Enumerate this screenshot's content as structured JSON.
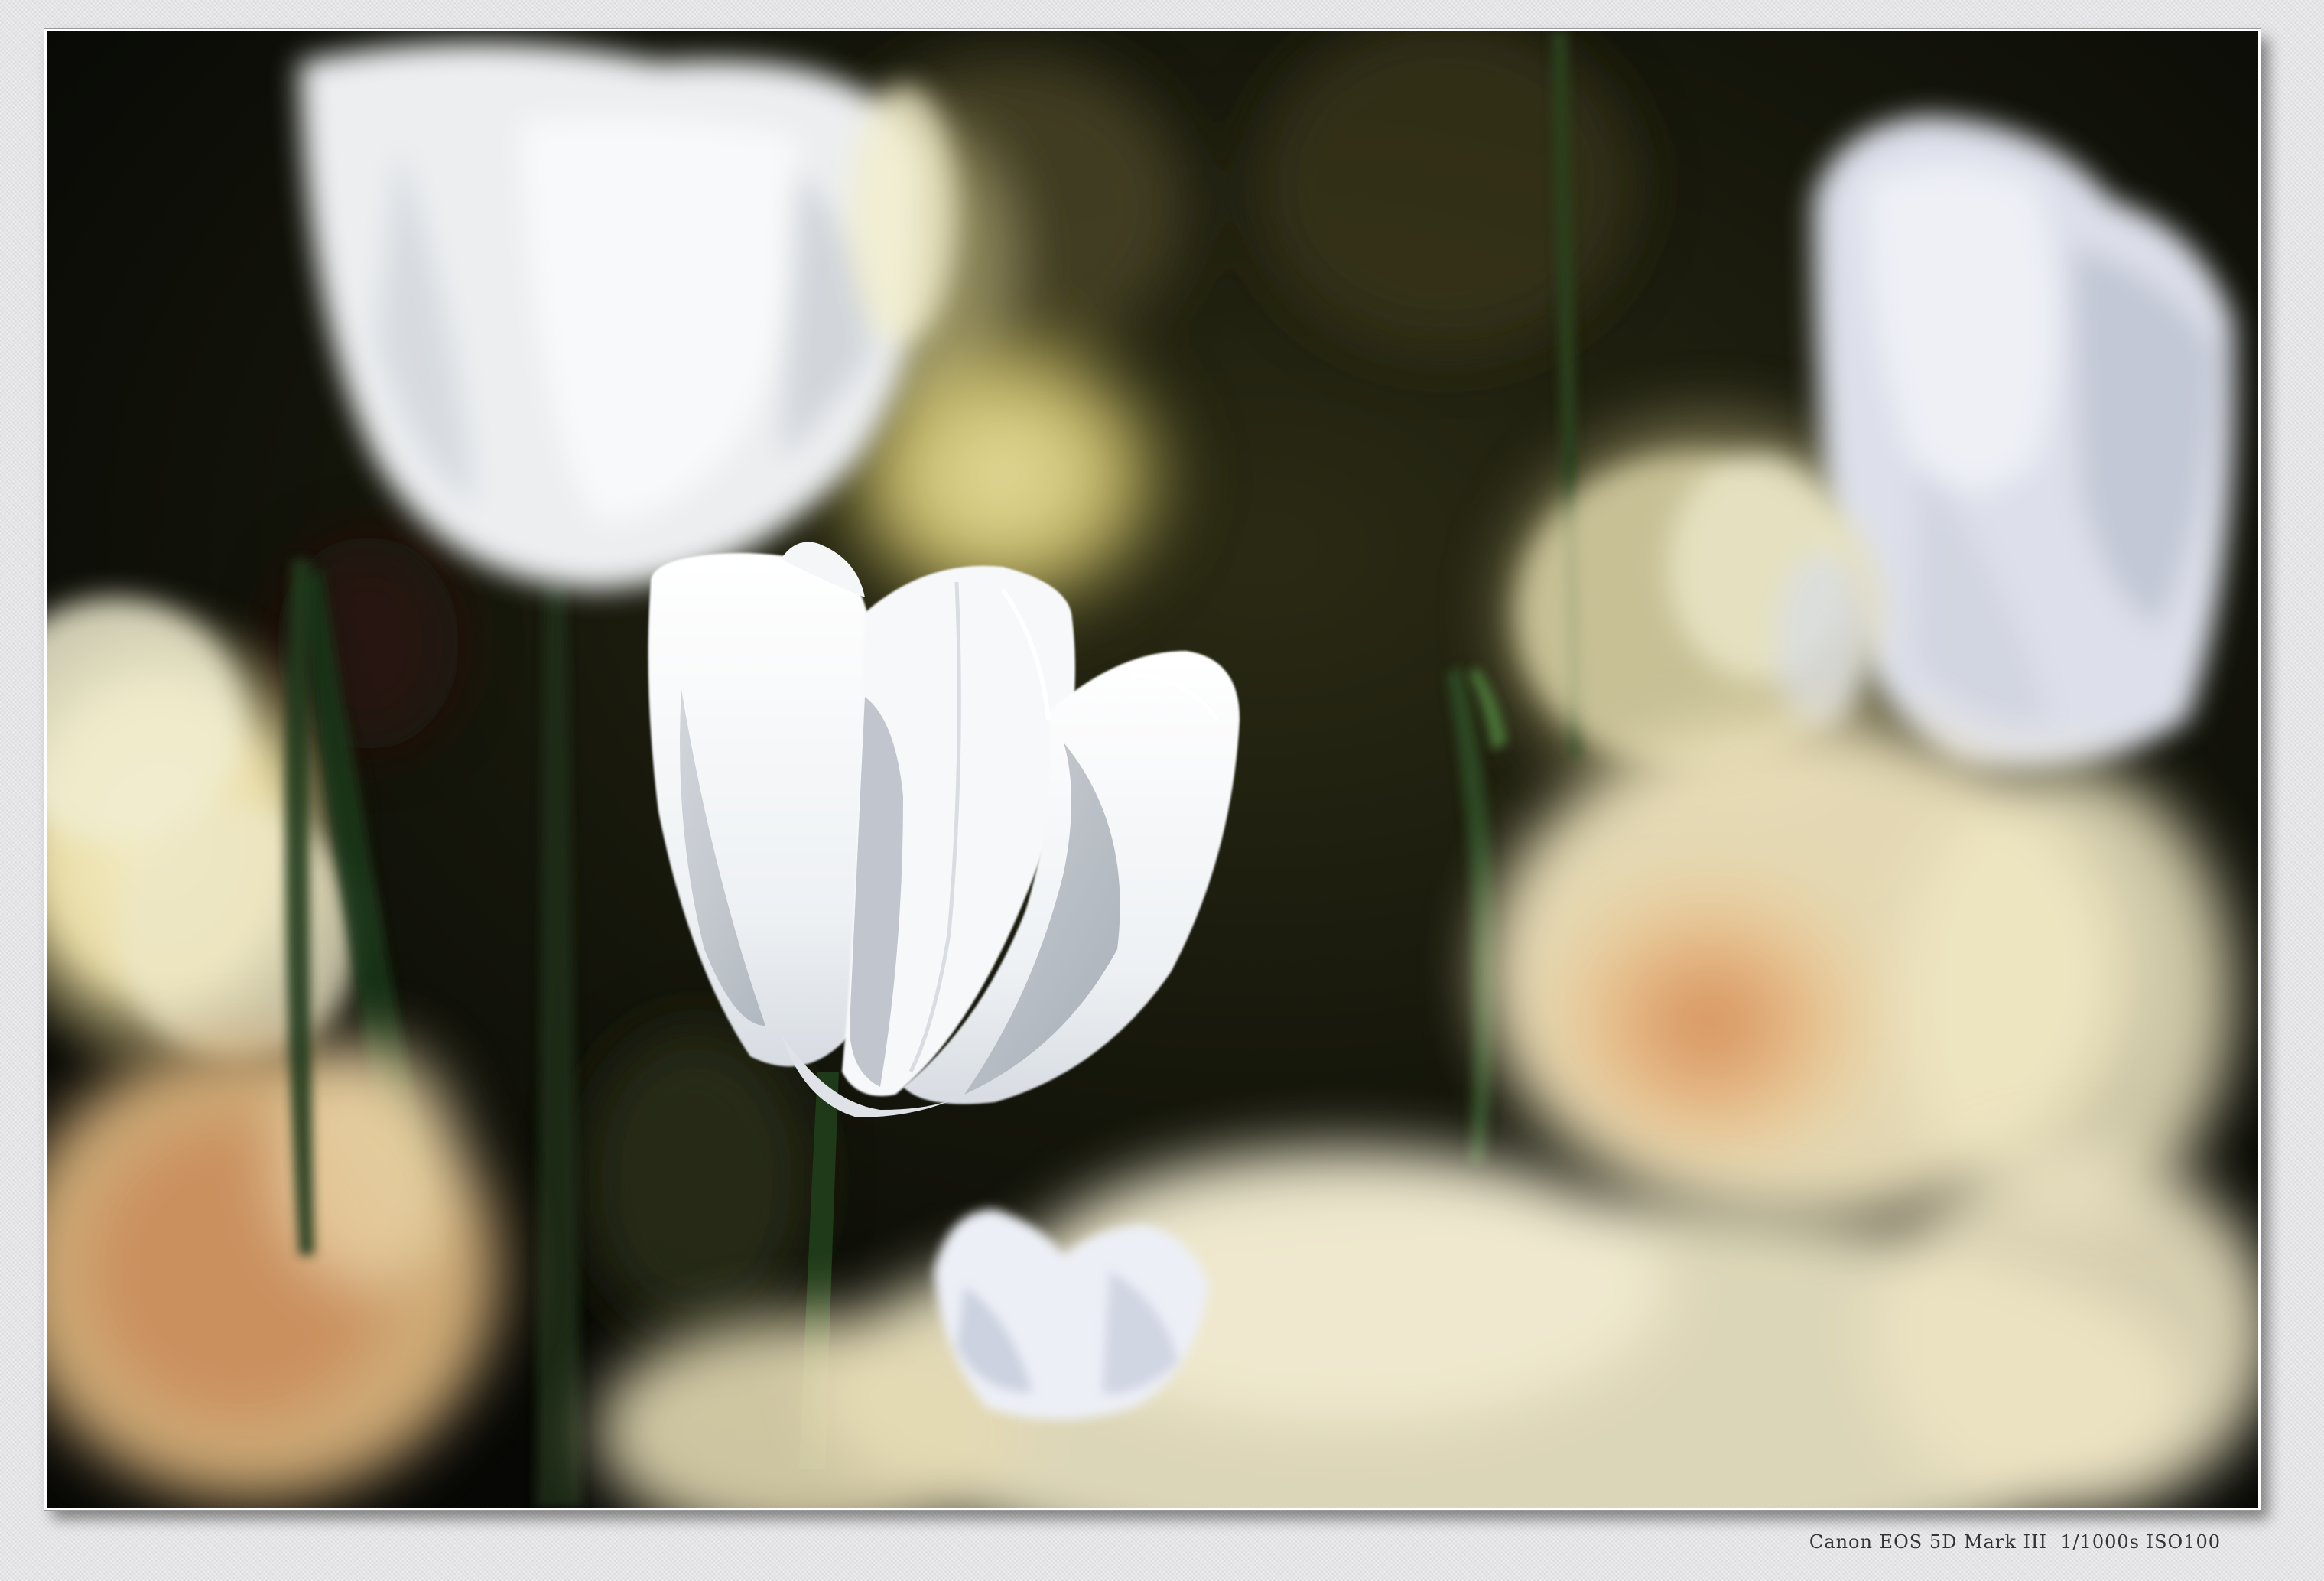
{
  "photo": {
    "subject": "white-tulips",
    "colors": {
      "background": "#0d0f07",
      "petal_white": "#f4f6f8",
      "petal_shadow": "#aab0b8",
      "cream": "#ece3b8",
      "peach": "#e0a070",
      "stem": "#1f3a18"
    }
  },
  "caption": {
    "camera": "Canon EOS 5D Mark III",
    "exposure": "1/1000s ISO100"
  }
}
